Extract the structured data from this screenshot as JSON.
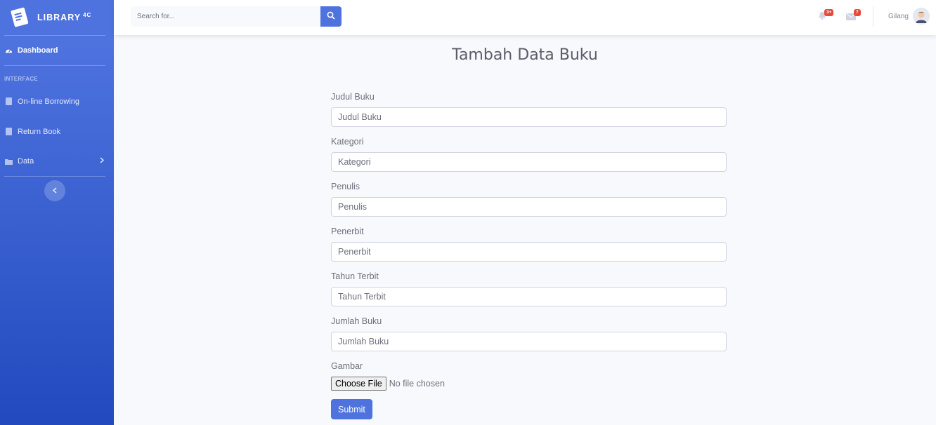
{
  "sidebar": {
    "brand": "LIBRARY",
    "brand_sup": "4C",
    "dashboard": "Dashboard",
    "heading": "INTERFACE",
    "items": [
      {
        "label": "On-line Borrowing"
      },
      {
        "label": "Return Book"
      },
      {
        "label": "Data"
      }
    ]
  },
  "topbar": {
    "search_placeholder": "Search for...",
    "alerts_badge": "3+",
    "messages_badge": "7",
    "user_name": "Gilang"
  },
  "form": {
    "title": "Tambah Data Buku",
    "fields": [
      {
        "label": "Judul Buku",
        "placeholder": "Judul Buku"
      },
      {
        "label": "Kategori",
        "placeholder": "Kategori"
      },
      {
        "label": "Penulis",
        "placeholder": "Penulis"
      },
      {
        "label": "Penerbit",
        "placeholder": "Penerbit"
      },
      {
        "label": "Tahun Terbit",
        "placeholder": "Tahun Terbit"
      },
      {
        "label": "Jumlah Buku",
        "placeholder": "Jumlah Buku"
      }
    ],
    "image_label": "Gambar",
    "file_button": "Choose File",
    "file_status": "No file chosen",
    "submit": "Submit"
  },
  "colors": {
    "primary": "#4e73df",
    "sidebar_end": "#224abe",
    "badge": "#e74a3b"
  }
}
